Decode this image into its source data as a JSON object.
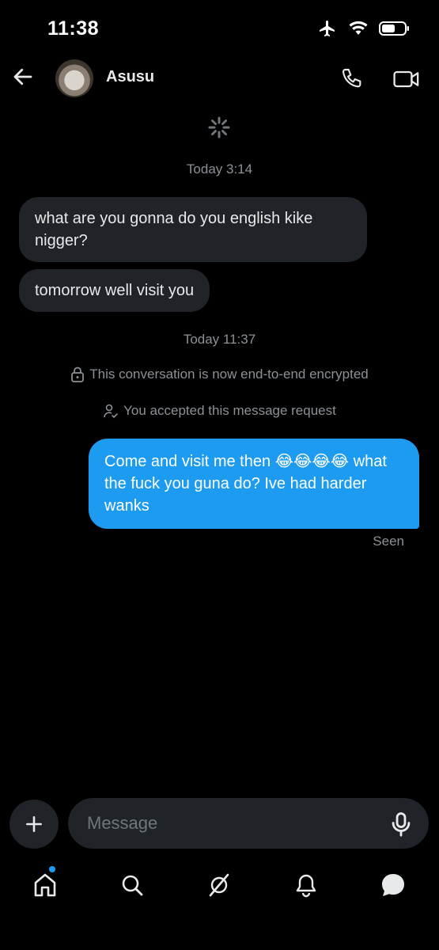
{
  "status_bar": {
    "time": "11:38"
  },
  "header": {
    "contact_name": "Asusu"
  },
  "conversation": {
    "timestamp_1": "Today 3:14",
    "incoming_1": "what are you gonna do you english kike nigger?",
    "incoming_2": "tomorrow well visit you",
    "timestamp_2": "Today 11:37",
    "encrypted_note": "This conversation is now end-to-end encrypted",
    "accepted_note": "You accepted this message request",
    "outgoing_1": "Come and visit me then 😂😂😂😂 what the fuck you guna do? Ive had harder wanks",
    "seen_label": "Seen"
  },
  "composer": {
    "placeholder": "Message"
  },
  "tabbar": {
    "icons": [
      "home-icon",
      "search-icon",
      "grok-icon",
      "bell-icon",
      "messages-icon"
    ]
  },
  "colors": {
    "accent": "#1d9bf0",
    "incoming_bubble": "#202327",
    "background": "#000000"
  }
}
